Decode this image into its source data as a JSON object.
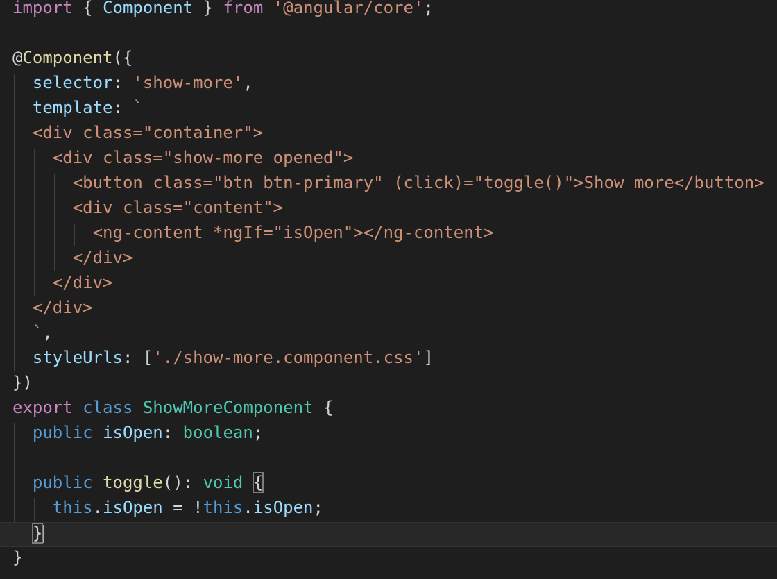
{
  "theme": {
    "background": "#1e1e1e",
    "current_line": "#282828",
    "indent_guide": "#404040",
    "colors": {
      "keyword": "#c586c0",
      "storage": "#569cd6",
      "identifier": "#9cdcfe",
      "class_name": "#4ec9b0",
      "function": "#dcdcaa",
      "string": "#ce9178",
      "default": "#d4d4d4"
    }
  },
  "editor": {
    "lines": [
      {
        "tokens": [
          {
            "text": "import",
            "type": "keyword"
          },
          {
            "text": " { ",
            "type": "default"
          },
          {
            "text": "Component",
            "type": "identifier"
          },
          {
            "text": " } ",
            "type": "default"
          },
          {
            "text": "from",
            "type": "keyword"
          },
          {
            "text": " ",
            "type": "default"
          },
          {
            "text": "'@angular/core'",
            "type": "string"
          },
          {
            "text": ";",
            "type": "default"
          }
        ]
      },
      {
        "tokens": []
      },
      {
        "tokens": [
          {
            "text": "@",
            "type": "default"
          },
          {
            "text": "Component",
            "type": "function"
          },
          {
            "text": "({",
            "type": "default"
          }
        ]
      },
      {
        "tokens": [
          {
            "text": "  ",
            "type": "default"
          },
          {
            "text": "selector",
            "type": "identifier"
          },
          {
            "text": ": ",
            "type": "default"
          },
          {
            "text": "'show-more'",
            "type": "string"
          },
          {
            "text": ",",
            "type": "default"
          }
        ]
      },
      {
        "tokens": [
          {
            "text": "  ",
            "type": "default"
          },
          {
            "text": "template",
            "type": "identifier"
          },
          {
            "text": ": ",
            "type": "default"
          },
          {
            "text": "`",
            "type": "string"
          }
        ]
      },
      {
        "tokens": [
          {
            "text": "  <div class=\"container\">",
            "type": "string"
          }
        ]
      },
      {
        "tokens": [
          {
            "text": "    <div class=\"show-more opened\">",
            "type": "string"
          }
        ]
      },
      {
        "tokens": [
          {
            "text": "      <button class=\"btn btn-primary\" (click)=\"toggle()\">Show more</button>",
            "type": "string"
          }
        ]
      },
      {
        "tokens": [
          {
            "text": "      <div class=\"content\">",
            "type": "string"
          }
        ]
      },
      {
        "tokens": [
          {
            "text": "        <ng-content *ngIf=\"isOpen\"></ng-content>",
            "type": "string"
          }
        ]
      },
      {
        "tokens": [
          {
            "text": "      </div>",
            "type": "string"
          }
        ]
      },
      {
        "tokens": [
          {
            "text": "    </div>",
            "type": "string"
          }
        ]
      },
      {
        "tokens": [
          {
            "text": "  </div>",
            "type": "string"
          }
        ]
      },
      {
        "tokens": [
          {
            "text": "  `",
            "type": "string"
          },
          {
            "text": ",",
            "type": "default"
          }
        ]
      },
      {
        "tokens": [
          {
            "text": "  ",
            "type": "default"
          },
          {
            "text": "styleUrls",
            "type": "identifier"
          },
          {
            "text": ": [",
            "type": "default"
          },
          {
            "text": "'./show-more.component.css'",
            "type": "string"
          },
          {
            "text": "]",
            "type": "default"
          }
        ]
      },
      {
        "tokens": [
          {
            "text": "})",
            "type": "default"
          }
        ]
      },
      {
        "tokens": [
          {
            "text": "export",
            "type": "keyword"
          },
          {
            "text": " ",
            "type": "default"
          },
          {
            "text": "class",
            "type": "storage"
          },
          {
            "text": " ",
            "type": "default"
          },
          {
            "text": "ShowMoreComponent",
            "type": "class_name"
          },
          {
            "text": " {",
            "type": "default"
          }
        ]
      },
      {
        "tokens": [
          {
            "text": "  ",
            "type": "default"
          },
          {
            "text": "public",
            "type": "storage"
          },
          {
            "text": " ",
            "type": "default"
          },
          {
            "text": "isOpen",
            "type": "identifier"
          },
          {
            "text": ": ",
            "type": "default"
          },
          {
            "text": "boolean",
            "type": "class_name"
          },
          {
            "text": ";",
            "type": "default"
          }
        ]
      },
      {
        "tokens": []
      },
      {
        "tokens": [
          {
            "text": "  ",
            "type": "default"
          },
          {
            "text": "public",
            "type": "storage"
          },
          {
            "text": " ",
            "type": "default"
          },
          {
            "text": "toggle",
            "type": "function"
          },
          {
            "text": "(): ",
            "type": "default"
          },
          {
            "text": "void",
            "type": "class_name"
          },
          {
            "text": " ",
            "type": "default"
          },
          {
            "text": "{",
            "type": "default",
            "match": true
          }
        ]
      },
      {
        "tokens": [
          {
            "text": "    ",
            "type": "default"
          },
          {
            "text": "this",
            "type": "storage"
          },
          {
            "text": ".",
            "type": "default"
          },
          {
            "text": "isOpen",
            "type": "identifier"
          },
          {
            "text": " = !",
            "type": "default"
          },
          {
            "text": "this",
            "type": "storage"
          },
          {
            "text": ".",
            "type": "default"
          },
          {
            "text": "isOpen",
            "type": "identifier"
          },
          {
            "text": ";",
            "type": "default"
          }
        ]
      },
      {
        "tokens": [
          {
            "text": "  ",
            "type": "default"
          },
          {
            "text": "}",
            "type": "default",
            "match": true,
            "caret": true
          }
        ],
        "current": true
      },
      {
        "tokens": [
          {
            "text": "}",
            "type": "default"
          }
        ]
      }
    ]
  }
}
